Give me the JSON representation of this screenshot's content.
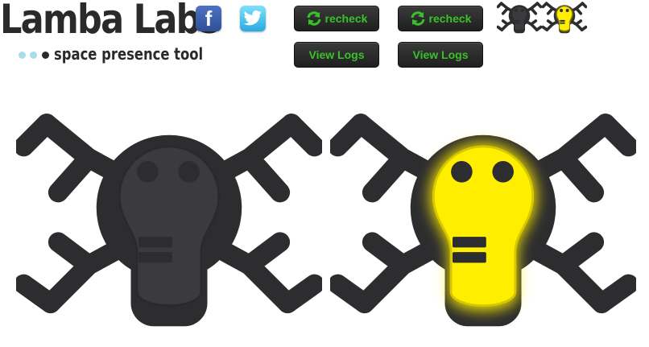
{
  "header": {
    "brand": "Lamba Labs",
    "tagline": "space presence tool"
  },
  "social": {
    "facebook_glyph": "f",
    "facebook_icon": "facebook-icon",
    "twitter_icon": "twitter-icon"
  },
  "panels": [
    {
      "recheck_label": "recheck",
      "logs_label": "View Logs",
      "status": "off",
      "color": "#3b3b3e"
    },
    {
      "recheck_label": "recheck",
      "logs_label": "View Logs",
      "status": "on",
      "color": "#ffee00"
    }
  ],
  "colors": {
    "accent_green": "#39c12a",
    "bug_body": "#2d2d2f",
    "bulb_off": "#3b3b3e",
    "bulb_on": "#ffee00",
    "brand_text": "#2a2a2a"
  }
}
